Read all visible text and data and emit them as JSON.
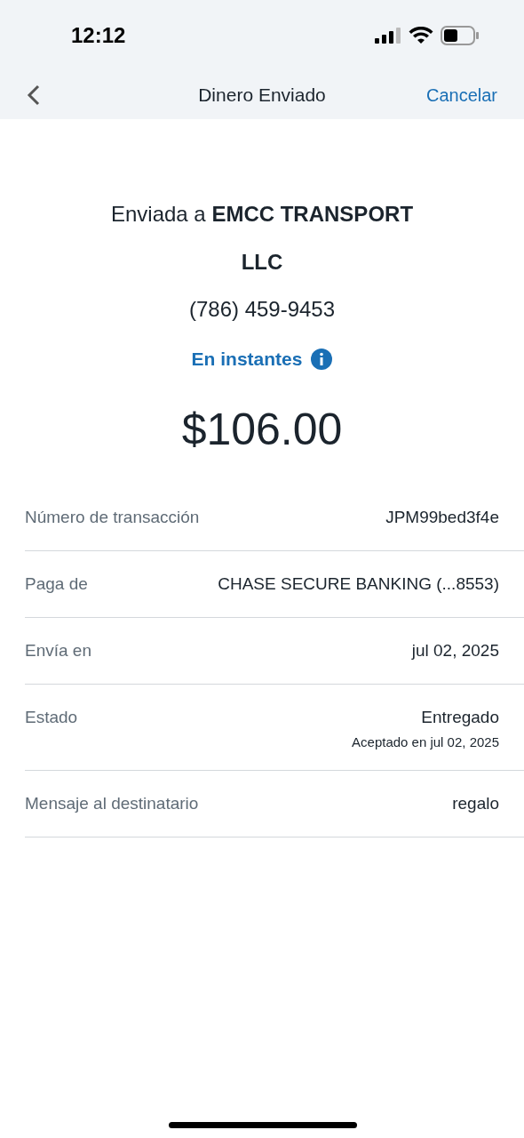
{
  "status_bar": {
    "time": "12:12"
  },
  "nav": {
    "title": "Dinero Enviado",
    "action": "Cancelar"
  },
  "summary": {
    "recipient": "Enviada a **EMCC TRANSPORT LLC**",
    "phone": "(786) 459-9453",
    "speed": "En instantes",
    "amount": "$106.00"
  },
  "details": [
    {
      "label": "Número de transacción",
      "value": "JPM99bed3f4e"
    },
    {
      "label": "Paga de",
      "value": "CHASE SECURE BANKING (...8553)"
    },
    {
      "label": "Envía en",
      "value": "jul 02, 2025"
    },
    {
      "label": "Estado",
      "value": "Entregado",
      "note": "Aceptado en jul 02, 2025"
    },
    {
      "label": "Mensaje al destinatario",
      "value": "regalo"
    }
  ]
}
